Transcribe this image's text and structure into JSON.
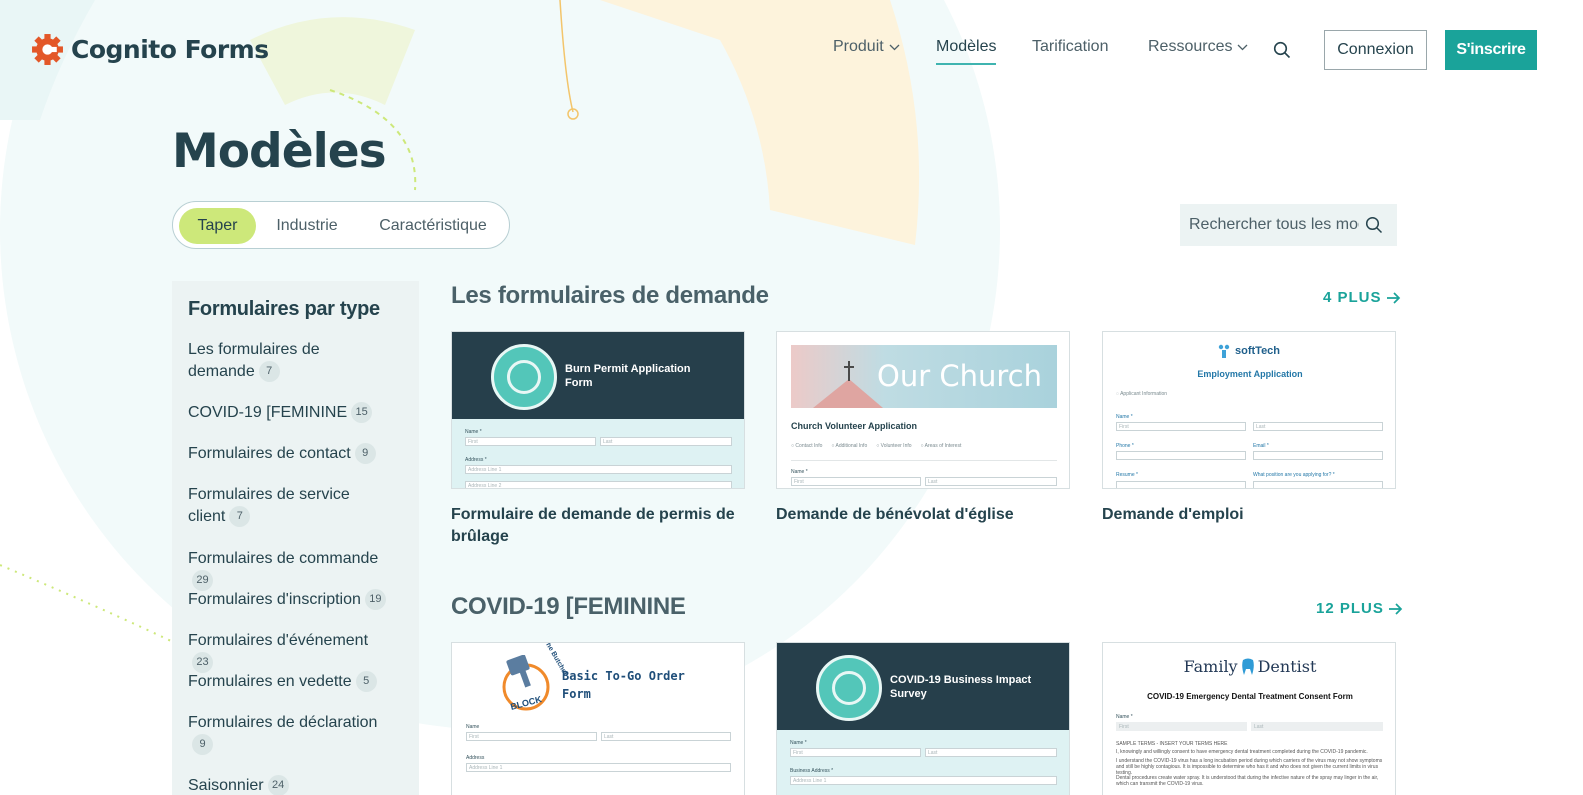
{
  "brand": {
    "name": "Cognito Forms",
    "accent": "#1aa39a",
    "dark": "#25434d",
    "lime": "#cde87a"
  },
  "nav": {
    "items": [
      {
        "label": "Produit",
        "has_dropdown": true
      },
      {
        "label": "Modèles",
        "active": true
      },
      {
        "label": "Tarification"
      },
      {
        "label": "Ressources",
        "has_dropdown": true
      }
    ],
    "login": "Connexion",
    "signup": "S'inscrire"
  },
  "page": {
    "title": "Modèles"
  },
  "filters": {
    "tabs": [
      "Taper",
      "Industrie",
      "Caractéristique"
    ],
    "active": "Taper"
  },
  "search": {
    "placeholder": "Rechercher tous les modèles"
  },
  "sidebar": {
    "title": "Formulaires par type",
    "items": [
      {
        "label": "Les formulaires de demande",
        "count": "7"
      },
      {
        "label": "COVID-19 [FEMININE",
        "count": "15"
      },
      {
        "label": "Formulaires de contact",
        "count": "9"
      },
      {
        "label": "Formulaires de service client",
        "count": "7"
      },
      {
        "label": "Formulaires de commande",
        "count": "29"
      },
      {
        "label": "Formulaires d'inscription",
        "count": "19"
      },
      {
        "label": "Formulaires d'événement",
        "count": "23"
      },
      {
        "label": "Formulaires en vedette",
        "count": "5"
      },
      {
        "label": "Formulaires de déclaration",
        "count": "9"
      },
      {
        "label": "Saisonnier",
        "count": "24"
      }
    ]
  },
  "sections": [
    {
      "title": "Les formulaires de demande",
      "more": "4 PLUS",
      "cards": [
        {
          "label": "Formulaire de demande de permis de brûlage",
          "thumb_title": "Burn Permit Application Form",
          "fields": [
            "Name *",
            "First",
            "Last",
            "Address *",
            "Address Line 1",
            "Address Line 2"
          ]
        },
        {
          "label": "Demande de bénévolat d'église",
          "banner": "Our Church",
          "thumb_title": "Church Volunteer Application",
          "steps": [
            "Contact Info",
            "Additional Info",
            "Volunteer Info",
            "Areas of Interest"
          ],
          "fields": [
            "Name *",
            "First",
            "Last"
          ]
        },
        {
          "label": "Demande d'emploi",
          "logo": "softTech",
          "thumb_title": "Employment Application",
          "section": "Applicant Information",
          "fields": [
            "Name *",
            "First",
            "Last",
            "Phone *",
            "Email *",
            "Resume *",
            "What position are you applying for? *"
          ]
        }
      ]
    },
    {
      "title": "COVID-19 [FEMININE",
      "more": "12 PLUS",
      "cards": [
        {
          "label": "",
          "thumb_title": "Basic To-Go Order Form",
          "logo_top": "The Butcher",
          "logo_bottom": "BLOCK",
          "fields": [
            "Name",
            "First",
            "Last",
            "Address",
            "Address Line 1"
          ]
        },
        {
          "label": "",
          "thumb_title": "COVID-19 Business Impact Survey",
          "fields": [
            "Name *",
            "First",
            "Last",
            "Business Address *",
            "Address Line 1"
          ]
        },
        {
          "label": "",
          "logo_left": "Family",
          "logo_right": "Dentist",
          "thumb_title": "COVID-19 Emergency Dental Treatment Consent Form",
          "fields": [
            "Name *",
            "First",
            "Last"
          ],
          "body_heading": "SAMPLE TERMS - INSERT YOUR TERMS HERE",
          "body_lines": [
            "I, knowingly and willingly consent to have emergency dental treatment completed during the COVID-19 pandemic.",
            "I understand the COVID-19 virus has a long incubation period during which carriers of the virus may not show symptoms and still be highly contagious. It is impossible to determine who has it and who does not given the current limits in virus testing.",
            "Dental procedures create water spray. It is understood that during the infective nature of the spray may linger in the air, which can transmit the COVID-19 virus."
          ]
        }
      ]
    }
  ]
}
